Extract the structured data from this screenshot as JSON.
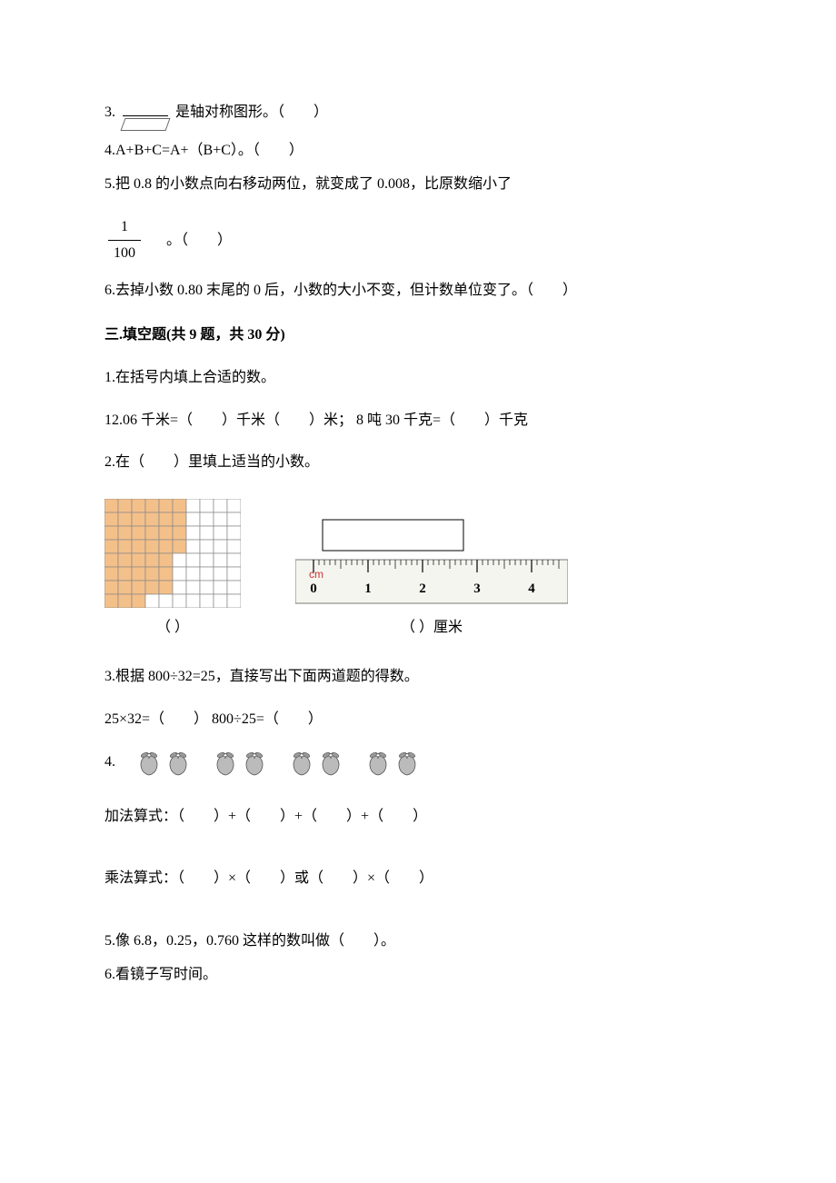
{
  "q3": {
    "prefix": "3.",
    "text": "是轴对称图形。（　　）"
  },
  "q4": {
    "text": "4.A+B+C=A+（B+C）。（　　）"
  },
  "q5": {
    "line1": "5.把 0.8 的小数点向右移动两位，就变成了 0.008，比原数缩小了",
    "frac_num": "1",
    "frac_den": "100",
    "tail": "。（　　）"
  },
  "q6": {
    "text": "6.去掉小数 0.80 末尾的 0 后，小数的大小不变，但计数单位变了。（　　）"
  },
  "section3": "三.填空题(共 9 题，共 30 分)",
  "f1": {
    "line1": "1.在括号内填上合适的数。",
    "line2": "12.06 千米=（　　）千米（　　）米；  8 吨 30 千克=（　　）千克"
  },
  "f2": {
    "line1": "2.在（　　）里填上适当的小数。",
    "cap1": "（    ）",
    "cap2": "（    ）厘米"
  },
  "f3": {
    "line1": "3.根据 800÷32=25，直接写出下面两道题的得数。",
    "line2": "25×32=（　　）        800÷25=（　　）"
  },
  "f4": {
    "prefix": "4.",
    "add": "加法算式：（　　）+（　　）+（　　）+（　　）",
    "mul": "乘法算式：（　　）×（　　）或（　　）×（　　）"
  },
  "f5": {
    "text": "5.像 6.8，0.25，0.760 这样的数叫做（　　）。"
  },
  "f6": {
    "text": "6.看镜子写时间。"
  },
  "chart_data": {
    "type": "table",
    "grid_figure": {
      "rows": 8,
      "cols": 10,
      "shaded_approx": 42,
      "unshaded_approx": 38
    },
    "ruler": {
      "unit": "cm",
      "ticks": [
        0,
        1,
        2,
        3,
        4
      ],
      "range": [
        0,
        4.5
      ],
      "object_span_cm": [
        0.2,
        3.0
      ]
    },
    "peaches": {
      "groups": 4,
      "per_group": 2,
      "total": 8
    }
  }
}
